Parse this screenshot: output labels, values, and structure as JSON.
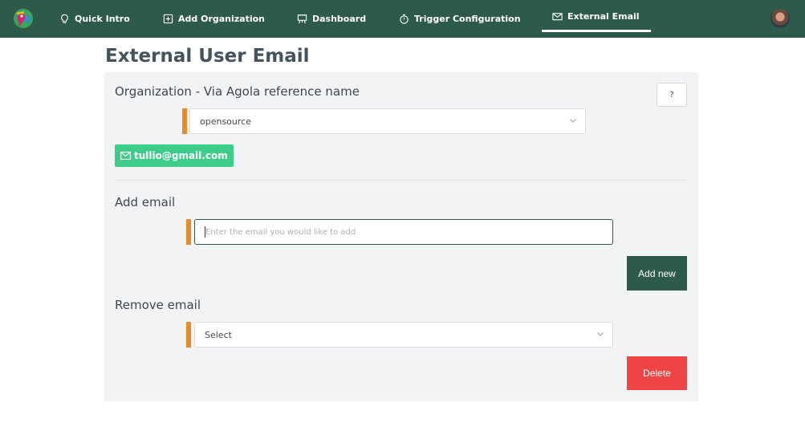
{
  "nav": {
    "items": [
      {
        "label": "Quick Intro",
        "icon": "lightbulb-icon"
      },
      {
        "label": "Add Organization",
        "icon": "plus-square-icon"
      },
      {
        "label": "Dashboard",
        "icon": "presentation-board-icon"
      },
      {
        "label": "Trigger Configuration",
        "icon": "stopwatch-icon"
      },
      {
        "label": "External Email",
        "icon": "envelope-icon",
        "active": true
      }
    ],
    "colors": {
      "background": "#2e5a4c",
      "text": "#ffffff"
    }
  },
  "page": {
    "title": "External User Email"
  },
  "organization": {
    "label": "Organization - Via Agola reference name",
    "selected": "opensource",
    "help_label": "?"
  },
  "emails": {
    "list": [
      "tullio@gmail.com"
    ],
    "badge_color": "#3ecc8b"
  },
  "add_email": {
    "label": "Add email",
    "placeholder": "Enter the email you would like to add",
    "value": "",
    "button_label": "Add new"
  },
  "remove_email": {
    "label": "Remove email",
    "selected": "Select",
    "button_label": "Delete"
  },
  "colors": {
    "accent": "#e88a2a",
    "primary": "#2e5a4c",
    "danger": "#ee4444",
    "panel": "#f2f3f4"
  }
}
